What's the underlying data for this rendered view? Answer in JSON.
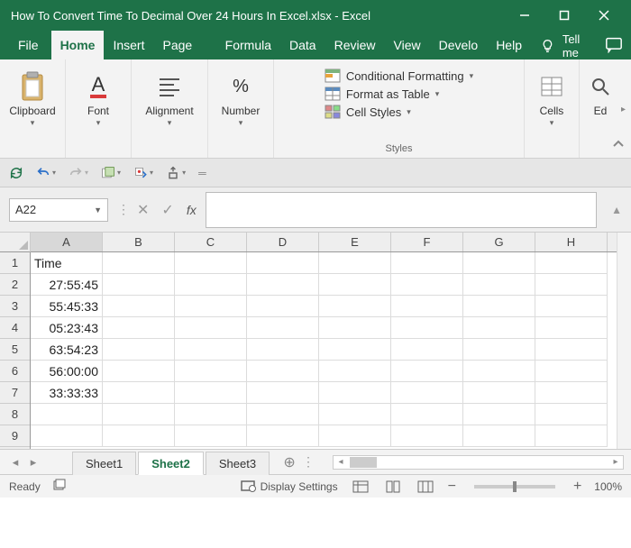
{
  "title": "How To Convert Time To Decimal Over 24 Hours In Excel.xlsx  -  Excel",
  "tabs": {
    "file": "File",
    "home": "Home",
    "insert": "Insert",
    "pagel": "Page La",
    "formul": "Formula",
    "data": "Data",
    "review": "Review",
    "view": "View",
    "develo": "Develo",
    "help": "Help",
    "tellme": "Tell me"
  },
  "ribbon": {
    "clipboard": "Clipboard",
    "font": "Font",
    "alignment": "Alignment",
    "number": "Number",
    "styles": "Styles",
    "cells": "Cells",
    "editing": "Ed",
    "condfmt": "Conditional Formatting",
    "fmttable": "Format as Table",
    "cellstyles": "Cell Styles"
  },
  "namebox": "A22",
  "fx": "fx",
  "columns": [
    "A",
    "B",
    "C",
    "D",
    "E",
    "F",
    "G",
    "H"
  ],
  "rows": [
    "1",
    "2",
    "3",
    "4",
    "5",
    "6",
    "7",
    "8",
    "9"
  ],
  "cells": {
    "A1": "Time",
    "A2": "27:55:45",
    "A3": "55:45:33",
    "A4": "05:23:43",
    "A5": "63:54:23",
    "A6": "56:00:00",
    "A7": "33:33:33"
  },
  "sheets": {
    "s1": "Sheet1",
    "s2": "Sheet2",
    "s3": "Sheet3"
  },
  "status": {
    "ready": "Ready",
    "disp": "Display Settings",
    "zoom": "100%"
  }
}
